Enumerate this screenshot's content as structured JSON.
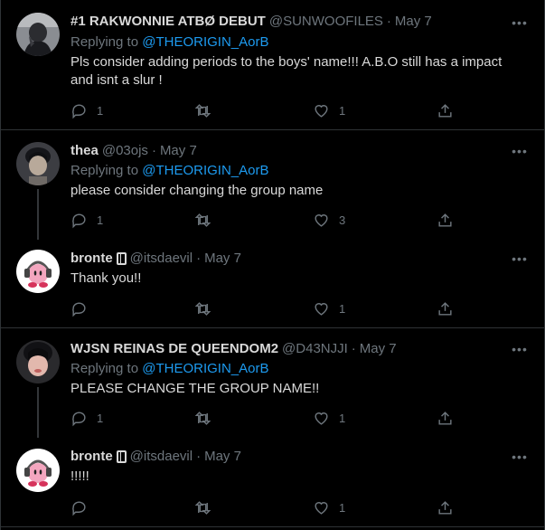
{
  "tweets": [
    {
      "name": "#1 RAKWONNIE ATBØ DEBUT",
      "handle": "@SUNWOOFILES",
      "date": "May 7",
      "replying_label": "Replying to",
      "replying_to": "@THEORIGIN_AorB",
      "text": "Pls consider adding periods to the boys' name!!! A.B.O still has a impact and isnt a slur !",
      "replies": "1",
      "retweets": "",
      "likes": "1",
      "avatar_icon": "profile-photo"
    },
    {
      "name": "thea",
      "handle": "@03ojs",
      "date": "May 7",
      "replying_label": "Replying to",
      "replying_to": "@THEORIGIN_AorB",
      "text": "please consider changing the group name",
      "replies": "1",
      "retweets": "",
      "likes": "3",
      "avatar_icon": "profile-photo"
    },
    {
      "name": "bronte",
      "handle": "@itsdaevil",
      "date": "May 7",
      "text": "Thank you!!",
      "replies": "",
      "retweets": "",
      "likes": "1",
      "avatar_icon": "kirby-headphones-avatar"
    },
    {
      "name": "WJSN REINAS DE QUEENDOM2",
      "handle": "@D43NJJI",
      "date": "May 7",
      "replying_label": "Replying to",
      "replying_to": "@THEORIGIN_AorB",
      "text": "PLEASE CHANGE THE GROUP NAME!!",
      "replies": "1",
      "retweets": "",
      "likes": "1",
      "avatar_icon": "profile-photo"
    },
    {
      "name": "bronte",
      "handle": "@itsdaevil",
      "date": "May 7",
      "text": "!!!!!",
      "replies": "",
      "retweets": "",
      "likes": "1",
      "avatar_icon": "kirby-headphones-avatar"
    }
  ],
  "colors": {
    "background": "#000000",
    "text": "#d9d9d9",
    "muted": "#6e767d",
    "link": "#1d9bf0",
    "border": "#2f3336"
  }
}
